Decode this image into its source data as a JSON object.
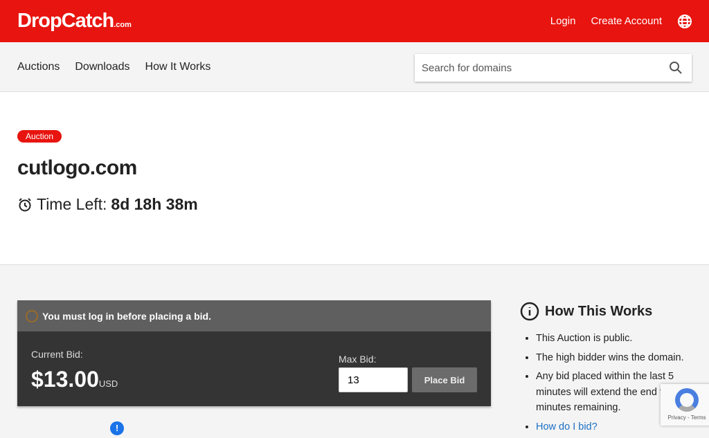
{
  "header": {
    "logo": "DropCatch",
    "logo_suffix": ".com",
    "login": "Login",
    "create_account": "Create Account"
  },
  "nav": {
    "items": [
      "Auctions",
      "Downloads",
      "How It Works"
    ],
    "search_placeholder": "Search for domains"
  },
  "auction": {
    "badge": "Auction",
    "domain": "cutlogo.com",
    "time_left_label": "Time Left:",
    "time_left": "8d 18h 38m"
  },
  "bid": {
    "warning": "You must log in before placing a bid.",
    "current_label": "Current Bid:",
    "current_amount": "$13.00",
    "currency": "USD",
    "max_label": "Max Bid:",
    "max_value": "13",
    "place_bid": "Place Bid"
  },
  "how": {
    "title": "How This Works",
    "items": [
      "This Auction is public.",
      "The high bidder wins the domain.",
      "Any bid placed within the last 5 minutes will extend the end to 5 minutes remaining."
    ],
    "link": "How do I bid?"
  },
  "recaptcha": {
    "text": "Privacy - Terms"
  }
}
